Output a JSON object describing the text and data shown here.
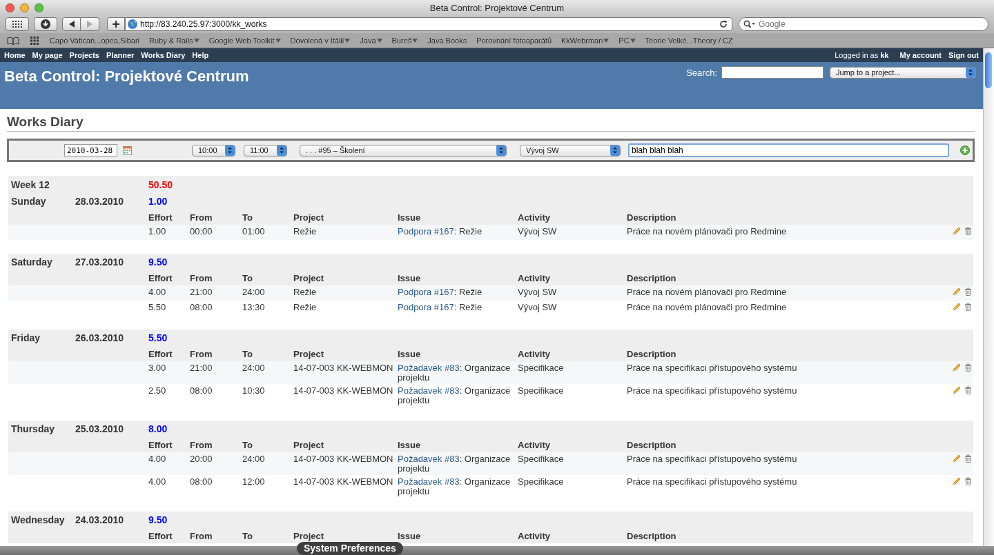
{
  "browser": {
    "title": "Beta Control: Projektové Centrum",
    "url": "http://83.240.25.97:3000/kk_works",
    "search_placeholder": "Google",
    "bookmarks": [
      {
        "label": "Capo Vatican...opea,Sibari",
        "menu": false
      },
      {
        "label": "Ruby & Rails",
        "menu": true
      },
      {
        "label": "Google Web Toolkit",
        "menu": true
      },
      {
        "label": "Dovolená v Itálii",
        "menu": true
      },
      {
        "label": "Java",
        "menu": true
      },
      {
        "label": "Bureš",
        "menu": true
      },
      {
        "label": "Java Books",
        "menu": false
      },
      {
        "label": "Porovnání fotoaparátů",
        "menu": false
      },
      {
        "label": "KkWebrman",
        "menu": true
      },
      {
        "label": "PC",
        "menu": true
      },
      {
        "label": "Teorie Velké...Theory / CZ",
        "menu": false
      }
    ]
  },
  "top_menu": [
    "Home",
    "My page",
    "Projects",
    "Planner",
    "Works Diary",
    "Help"
  ],
  "account": {
    "logged_in": "Logged in as **kk**",
    "links": [
      "My account",
      "Sign out"
    ]
  },
  "header": {
    "title": "Beta Control: Projektové Centrum",
    "search_label": "Search:",
    "jump_select": "Jump to a project..."
  },
  "page_title": "Works Diary",
  "form": {
    "date": "2010-03-28",
    "from": "10:00",
    "to": "11:00",
    "issue": ". . . #95 – Školení",
    "activity": "Vývoj SW",
    "description": "blah blah blah"
  },
  "weeks": [
    {
      "label": "Week 12",
      "total": "50.50",
      "days": [
        {
          "name": "Sunday",
          "date": "28.03.2010",
          "total": "1.00",
          "columns": [
            "Effort",
            "From",
            "To",
            "Project",
            "Issue",
            "Activity",
            "Description"
          ],
          "entries": [
            {
              "effort": "1.00",
              "from": "00:00",
              "to": "01:00",
              "project": "Režie",
              "issue_link": "Podpora #167",
              "issue_rest": ": Režie",
              "activity": "Vývoj SW",
              "description": "Práce na novém plánovači pro Redmine"
            }
          ]
        },
        {
          "name": "Saturday",
          "date": "27.03.2010",
          "total": "9.50",
          "columns": [
            "Effort",
            "From",
            "To",
            "Project",
            "Issue",
            "Activity",
            "Description"
          ],
          "entries": [
            {
              "effort": "4.00",
              "from": "21:00",
              "to": "24:00",
              "project": "Režie",
              "issue_link": "Podpora #167",
              "issue_rest": ": Režie",
              "activity": "Vývoj SW",
              "description": "Práce na novém plánovači pro Redmine"
            },
            {
              "effort": "5.50",
              "from": "08:00",
              "to": "13:30",
              "project": "Režie",
              "issue_link": "Podpora #167",
              "issue_rest": ": Režie",
              "activity": "Vývoj SW",
              "description": "Práce na novém plánovači pro Redmine"
            }
          ]
        },
        {
          "name": "Friday",
          "date": "26.03.2010",
          "total": "5.50",
          "columns": [
            "Effort",
            "From",
            "To",
            "Project",
            "Issue",
            "Activity",
            "Description"
          ],
          "entries": [
            {
              "effort": "3.00",
              "from": "21:00",
              "to": "24:00",
              "project": "14-07-003 KK-WEBMON",
              "issue_link": "Požadavek #83",
              "issue_rest": ": Organizace projektu",
              "activity": "Specifikace",
              "description": "Práce na specifikaci přístupového systému"
            },
            {
              "effort": "2.50",
              "from": "08:00",
              "to": "10:30",
              "project": "14-07-003 KK-WEBMON",
              "issue_link": "Požadavek #83",
              "issue_rest": ": Organizace projektu",
              "activity": "Specifikace",
              "description": "Práce na specifikaci přístupového systému"
            }
          ]
        },
        {
          "name": "Thursday",
          "date": "25.03.2010",
          "total": "8.00",
          "columns": [
            "Effort",
            "From",
            "To",
            "Project",
            "Issue",
            "Activity",
            "Description"
          ],
          "entries": [
            {
              "effort": "4.00",
              "from": "20:00",
              "to": "24:00",
              "project": "14-07-003 KK-WEBMON",
              "issue_link": "Požadavek #83",
              "issue_rest": ": Organizace projektu",
              "activity": "Specifikace",
              "description": "Práce na specifikaci přístupového systému"
            },
            {
              "effort": "4.00",
              "from": "08:00",
              "to": "12:00",
              "project": "14-07-003 KK-WEBMON",
              "issue_link": "Požadavek #83",
              "issue_rest": ": Organizace projektu",
              "activity": "Specifikace",
              "description": "Práce na specifikaci přístupového systému"
            }
          ]
        },
        {
          "name": "Wednesday",
          "date": "24.03.2010",
          "total": "9.50",
          "columns": [
            "Effort",
            "From",
            "To",
            "Project",
            "Issue",
            "Activity",
            "Description"
          ]
        }
      ]
    }
  ],
  "dock_tooltip": "System Preferences"
}
